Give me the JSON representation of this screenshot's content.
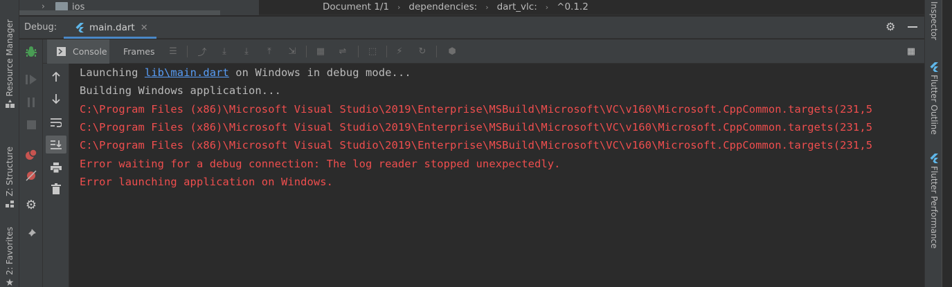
{
  "left_strip": {
    "tabs": [
      {
        "label": "Resource Manager",
        "icon": "resource-manager-icon"
      },
      {
        "label": "Z: Structure",
        "icon": "structure-icon"
      },
      {
        "label": "2: Favorites",
        "icon": "star-icon"
      }
    ]
  },
  "right_strip": {
    "tabs": [
      {
        "label": "Inspector",
        "icon": "inspector-icon"
      },
      {
        "label": "Flutter Outline",
        "icon": "flutter-icon"
      },
      {
        "label": "Flutter Performance",
        "icon": "flutter-icon"
      }
    ]
  },
  "top_bar": {
    "folder": "ios",
    "breadcrumb": [
      "Document 1/1",
      "dependencies:",
      "dart_vlc:",
      "^0.1.2"
    ]
  },
  "debug_header": {
    "label": "Debug:",
    "tab": "main.dart"
  },
  "console_tabs": {
    "console": "Console",
    "frames": "Frames"
  },
  "console": {
    "line1": {
      "prefix": "Launching ",
      "link": "lib\\main.dart",
      "suffix": " on Windows in debug mode..."
    },
    "line2": "Building Windows application...",
    "line3": "C:\\Program Files (x86)\\Microsoft Visual Studio\\2019\\Enterprise\\MSBuild\\Microsoft\\VC\\v160\\Microsoft.CppCommon.targets(231,5",
    "line4": "C:\\Program Files (x86)\\Microsoft Visual Studio\\2019\\Enterprise\\MSBuild\\Microsoft\\VC\\v160\\Microsoft.CppCommon.targets(231,5",
    "line5": "C:\\Program Files (x86)\\Microsoft Visual Studio\\2019\\Enterprise\\MSBuild\\Microsoft\\VC\\v160\\Microsoft.CppCommon.targets(231,5",
    "line6": "Error waiting for a debug connection: The log reader stopped unexpectedly.",
    "line7": "Error launching application on Windows."
  },
  "colors": {
    "background": "#2b2b2b",
    "panel": "#3c3f41",
    "normal_text": "#bbbbbb",
    "error_text": "#f04e4e",
    "link_text": "#589df6",
    "accent": "#4a88c7",
    "debug_green": "#499c54",
    "stop_red": "#c75450"
  }
}
